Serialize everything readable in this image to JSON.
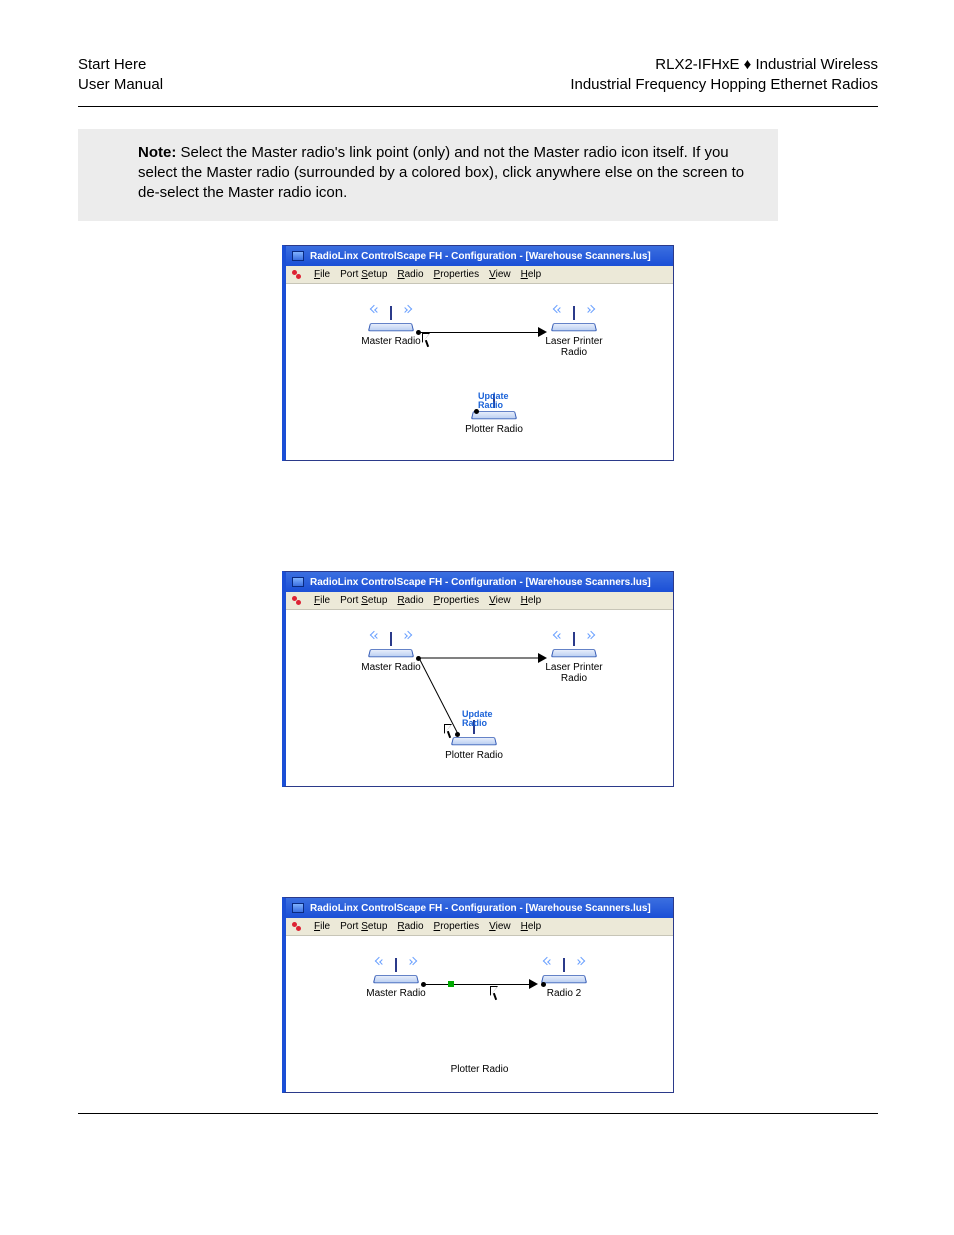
{
  "header": {
    "left_line1": "Start Here",
    "left_line2": "User Manual",
    "right_line1": "RLX2-IFHxE ♦ Industrial Wireless",
    "right_line2": "Industrial Frequency Hopping Ethernet Radios"
  },
  "note": {
    "label": "Note:",
    "text": " Select the Master radio's link point (only) and not the Master radio icon itself. If you select the Master radio (surrounded by a colored box), click anywhere else on the screen to de-select the Master radio icon."
  },
  "app": {
    "title": "RadioLinx ControlScape FH - Configuration - [Warehouse Scanners.lus]",
    "menus": {
      "file": "File",
      "port": "Port Setup",
      "radio": "Radio",
      "props": "Properties",
      "view": "View",
      "help": "Help"
    }
  },
  "labels": {
    "master": "Master Radio",
    "laser": "Laser Printer\nRadio",
    "plotter": "Plotter Radio",
    "radio2": "Radio 2",
    "update": "Update\nRadio"
  }
}
